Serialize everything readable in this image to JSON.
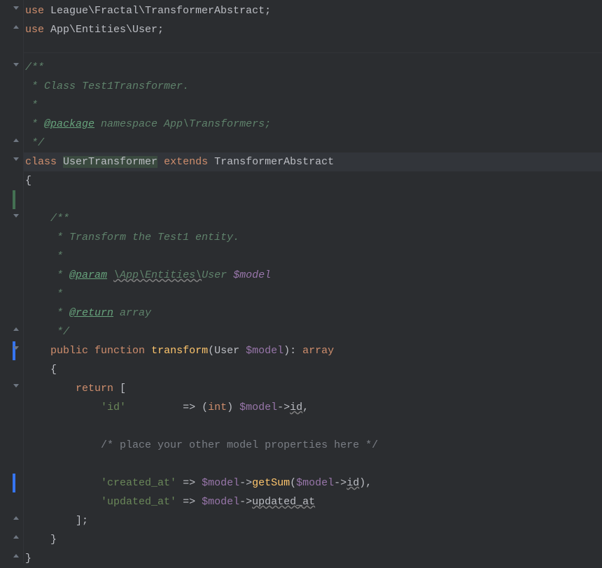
{
  "l1": {
    "use": "use ",
    "ns": "League\\Fractal\\TransformerAbstract",
    "semi": ";"
  },
  "l2": {
    "use": "use ",
    "ns": "App\\Entities\\User",
    "semi": ";"
  },
  "doc1": "/**",
  "doc2": " * Class Test1Transformer.",
  "doc3": " *",
  "doc4_pre": " * ",
  "doc4_tag": "@package",
  "doc4_post": " namespace App\\Transformers;",
  "doc5": " */",
  "classLine": {
    "class": "class ",
    "name": "UserTransformer",
    "sp": " ",
    "extends": "extends",
    "sp2": " ",
    "parent": "TransformerAbstract"
  },
  "obrace": "{",
  "mdoc1": "    /**",
  "mdoc2": "     * Transform the Test1 entity.",
  "mdoc3": "     *",
  "mdoc4_pre": "     * ",
  "mdoc4_tag": "@param",
  "mdoc4_mid": " ",
  "mdoc4_ns": "\\App\\Entities\\",
  "mdoc4_cls": "User ",
  "mdoc4_var": "$model",
  "mdoc5": "     *",
  "mdoc6_pre": "     * ",
  "mdoc6_tag": "@return",
  "mdoc6_post": " array",
  "mdoc7": "     */",
  "fn": {
    "ind": "    ",
    "pub": "public",
    "fun": "function",
    "name": "transform",
    "op": "(",
    "type": "User ",
    "var": "$model",
    "cp": ")",
    "colon": ": ",
    "ret": "array"
  },
  "fob": "    {",
  "ret": {
    "ind": "        ",
    "kw": "return",
    "br": " ["
  },
  "row_id": {
    "ind": "            ",
    "key": "'id'",
    "pad": "         ",
    "arrow": "=> ",
    "op": "(",
    "cast": "int",
    "cp": ") ",
    "var": "$model",
    "arr": "->",
    "prop": "id",
    "comma": ","
  },
  "cmt_line": {
    "ind": "            ",
    "txt": "/* place your other model properties here */"
  },
  "row_ca": {
    "ind": "            ",
    "key": "'created_at'",
    "pad": " ",
    "arrow": "=> ",
    "var": "$model",
    "arr": "->",
    "meth": "getSum",
    "op": "(",
    "var2": "$model",
    "arr2": "->",
    "prop": "id",
    "cp": ")",
    "comma": ","
  },
  "row_ua": {
    "ind": "            ",
    "key": "'updated_at'",
    "pad": " ",
    "arrow": "=> ",
    "var": "$model",
    "arr": "->",
    "prop": "updated_at"
  },
  "arr_close": {
    "ind": "        ",
    "br": "];"
  },
  "fcb": "    }",
  "ccb": "}"
}
